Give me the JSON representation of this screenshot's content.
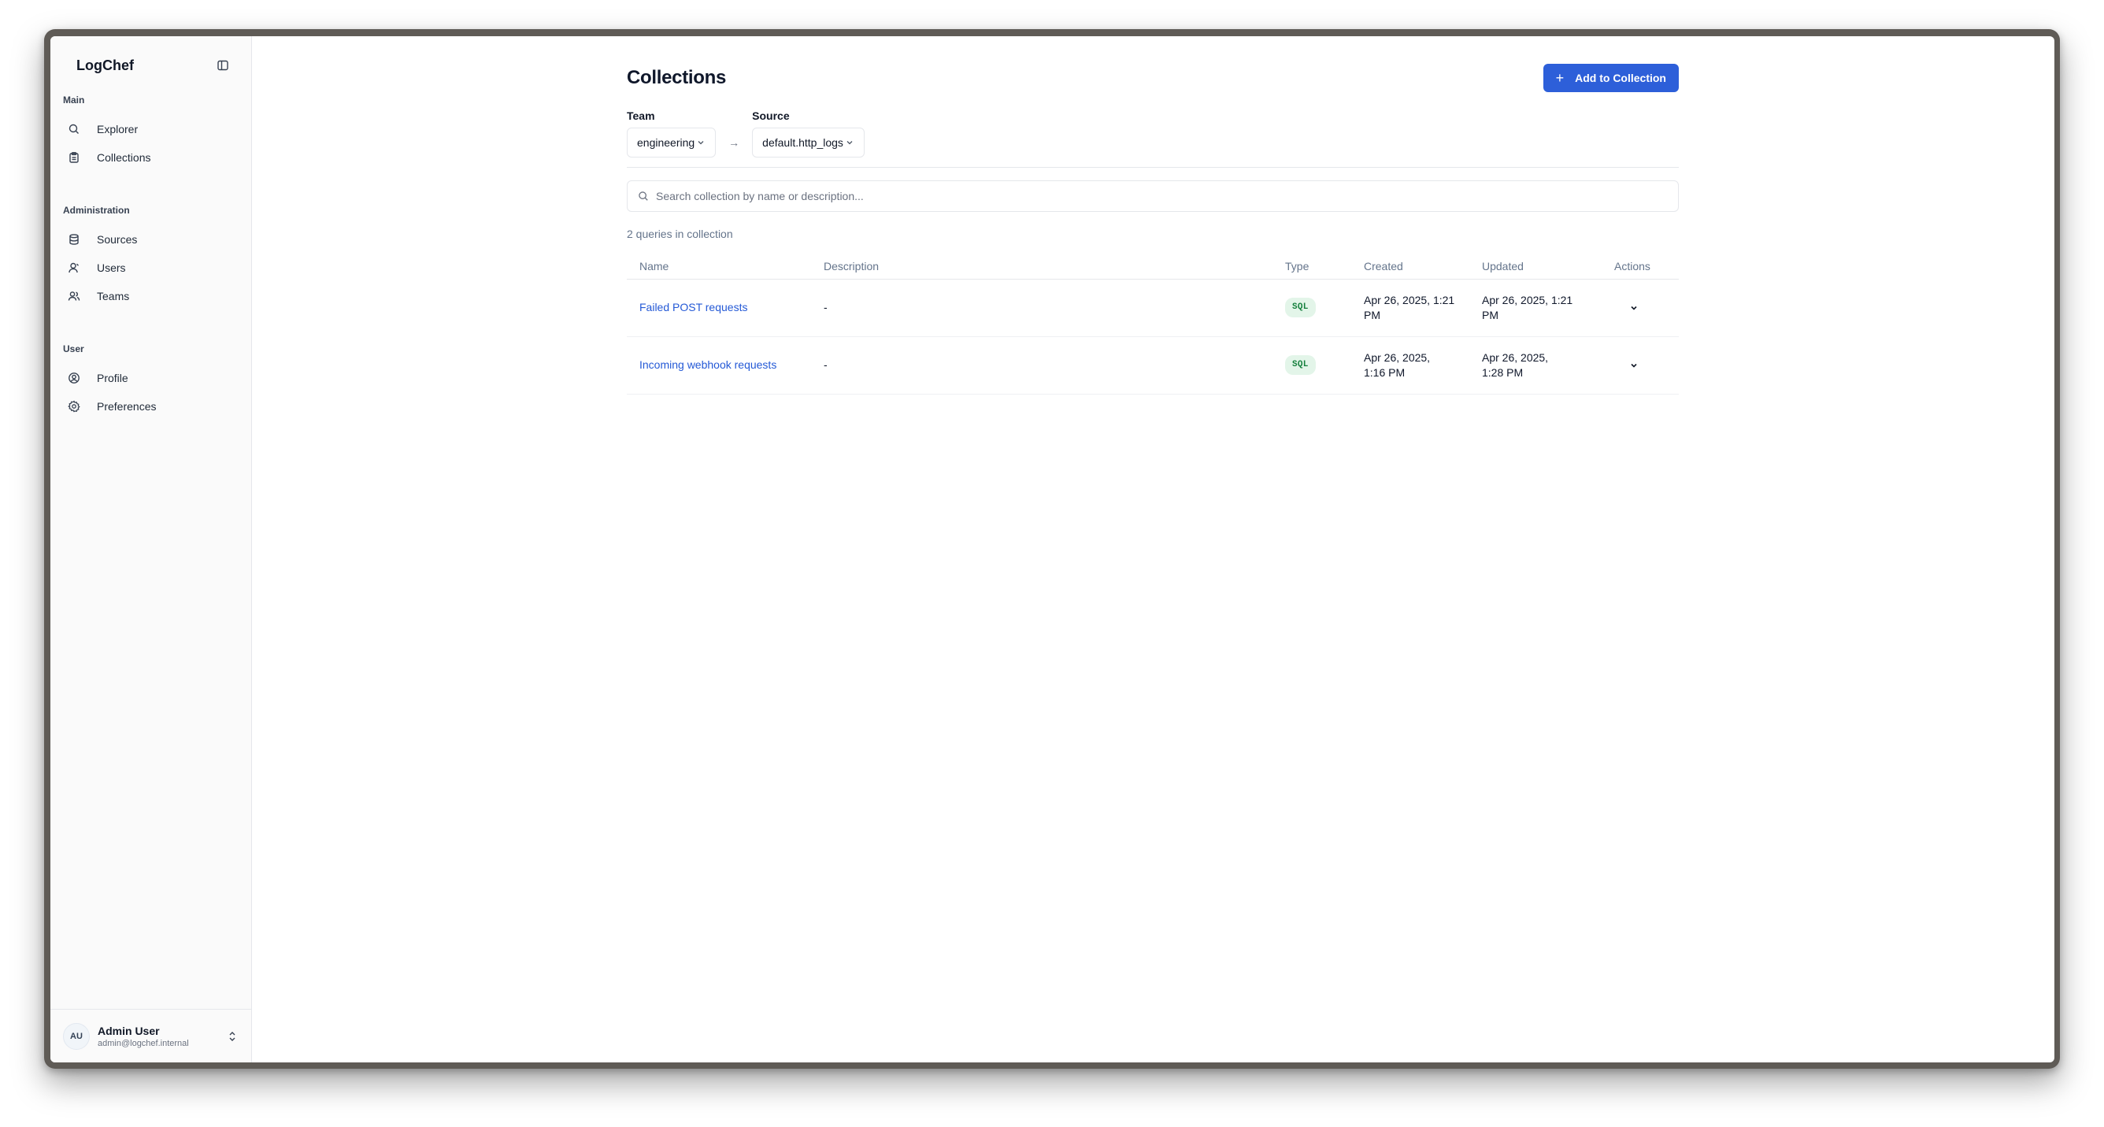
{
  "sidebar": {
    "brand": "LogChef",
    "groups": [
      {
        "label": "Main",
        "items": [
          {
            "label": "Explorer",
            "icon": "search-icon"
          },
          {
            "label": "Collections",
            "icon": "clipboard-icon"
          }
        ]
      },
      {
        "label": "Administration",
        "items": [
          {
            "label": "Sources",
            "icon": "database-icon"
          },
          {
            "label": "Users",
            "icon": "user-icon"
          },
          {
            "label": "Teams",
            "icon": "users-icon"
          }
        ]
      },
      {
        "label": "User",
        "items": [
          {
            "label": "Profile",
            "icon": "user-circle-icon"
          },
          {
            "label": "Preferences",
            "icon": "gear-icon"
          }
        ]
      }
    ],
    "user": {
      "initials": "AU",
      "name": "Admin User",
      "email": "admin@logchef.internal"
    }
  },
  "main": {
    "title": "Collections",
    "add_button_label": "Add to Collection",
    "team_label": "Team",
    "team_value": "engineering",
    "source_label": "Source",
    "source_value": "default.http_logs",
    "arrow": "→",
    "search_placeholder": "Search collection by name or description...",
    "count_text": "2 queries in collection",
    "table": {
      "headers": {
        "name": "Name",
        "description": "Description",
        "type": "Type",
        "created": "Created",
        "updated": "Updated",
        "actions": "Actions"
      },
      "rows": [
        {
          "name": "Failed POST requests",
          "description": "-",
          "type": "SQL",
          "created": "Apr 26, 2025, 1:21 PM",
          "updated": "Apr 26, 2025, 1:21 PM"
        },
        {
          "name": "Incoming webhook requests",
          "description": "-",
          "type": "SQL",
          "created": "Apr 26, 2025, 1:16 PM",
          "updated": "Apr 26, 2025, 1:28 PM"
        }
      ]
    }
  },
  "colors": {
    "accent": "#2d5fd9",
    "link": "#2459d6",
    "badge_bg": "#e3f5e9",
    "badge_text": "#15803d"
  }
}
